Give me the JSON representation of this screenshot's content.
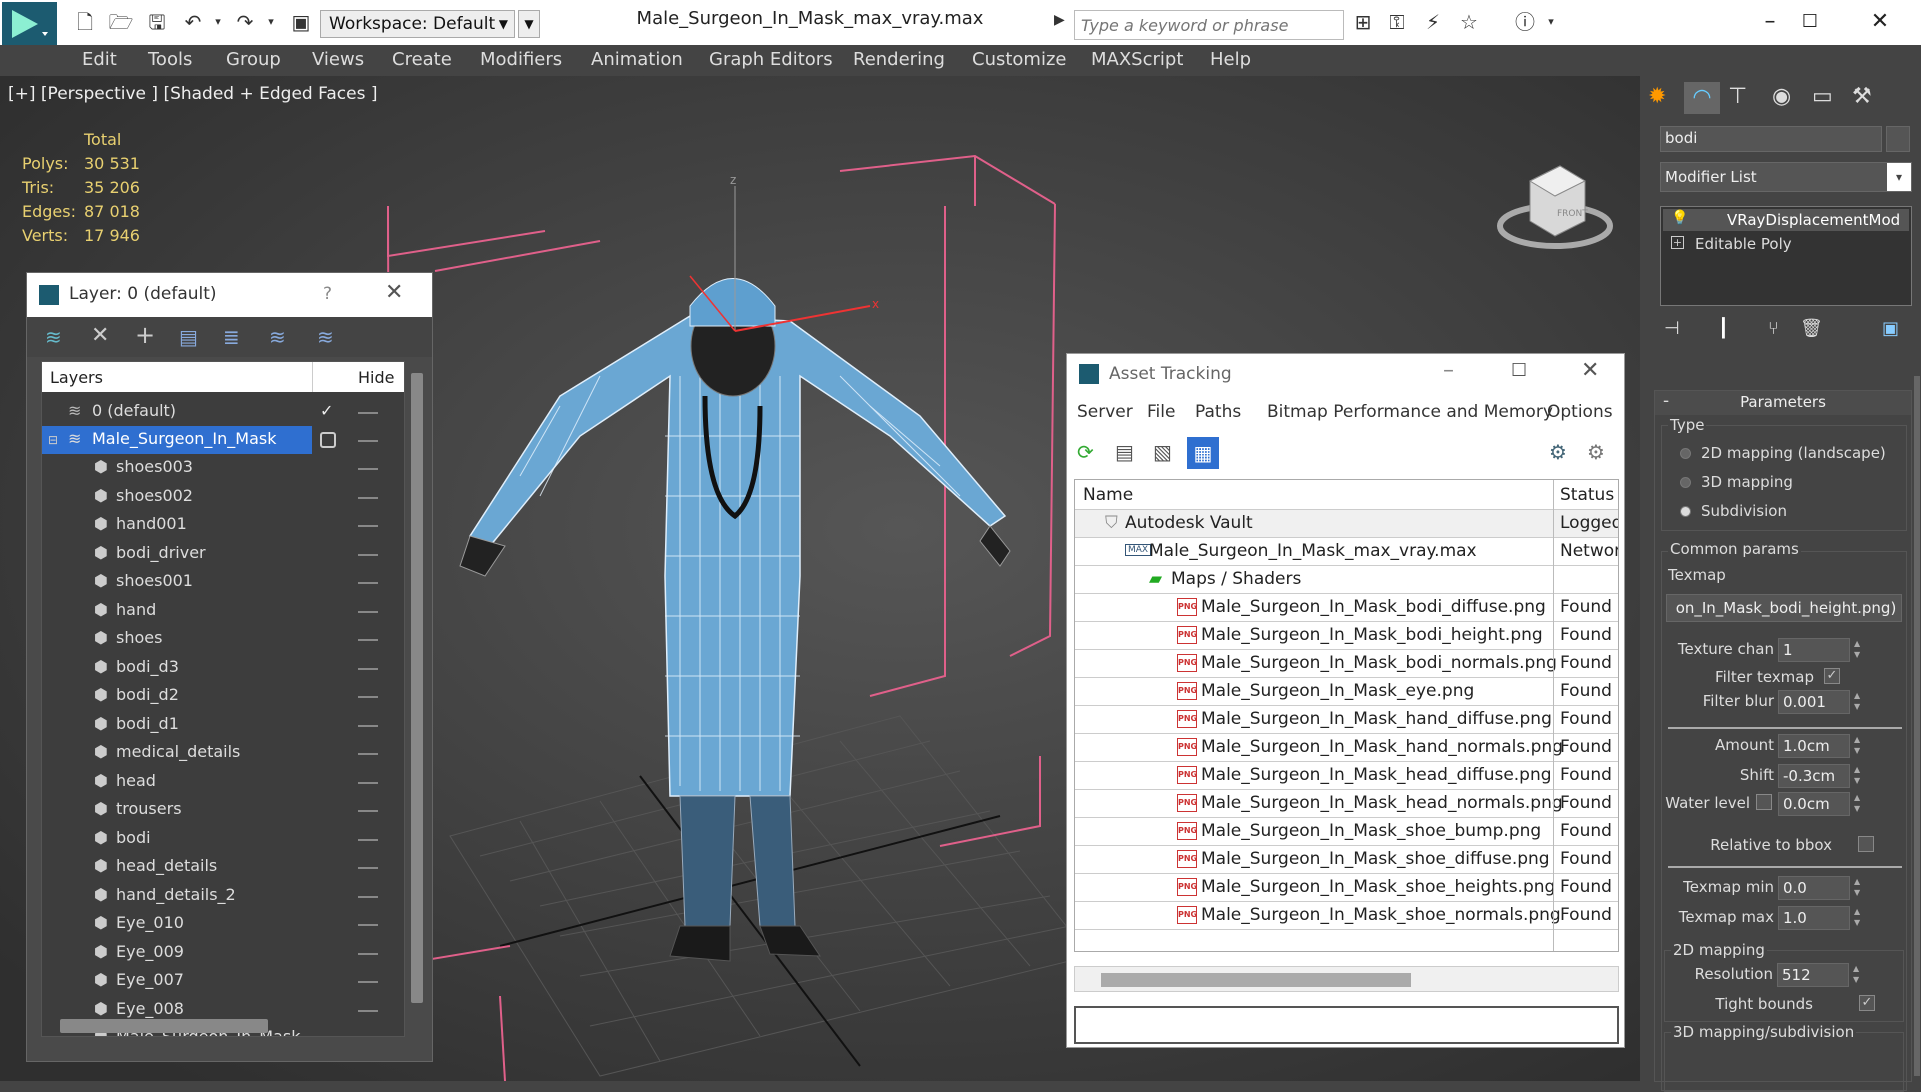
{
  "titlebar": {
    "workspace": "Workspace: Default",
    "doc_title": "Male_Surgeon_In_Mask_max_vray.max",
    "search_placeholder": "Type a keyword or phrase"
  },
  "menu": [
    "Edit",
    "Tools",
    "Group",
    "Views",
    "Create",
    "Modifiers",
    "Animation",
    "Graph Editors",
    "Rendering",
    "Customize",
    "MAXScript",
    "Help"
  ],
  "viewport": {
    "label": "[+] [Perspective ] [Shaded + Edged Faces ]",
    "stats_header": "Total",
    "stats": [
      {
        "label": "Polys:",
        "value": "30 531"
      },
      {
        "label": "Tris:",
        "value": "35 206"
      },
      {
        "label": "Edges:",
        "value": "87 018"
      },
      {
        "label": "Verts:",
        "value": "17 946"
      }
    ]
  },
  "layer_window": {
    "title": "Layer: 0 (default)",
    "help": "?",
    "col_layers": "Layers",
    "col_hide": "Hide",
    "default_layer": "0 (default)",
    "selected_layer": "Male_Surgeon_In_Mask",
    "objects": [
      "shoes003",
      "shoes002",
      "hand001",
      "bodi_driver",
      "shoes001",
      "hand",
      "shoes",
      "bodi_d3",
      "bodi_d2",
      "bodi_d1",
      "medical_details",
      "head",
      "trousers",
      "bodi",
      "head_details",
      "hand_details_2",
      "Eye_010",
      "Eye_009",
      "Eye_007",
      "Eye_008",
      "Male_Surgeon_In_Mask"
    ]
  },
  "asset_window": {
    "title": "Asset Tracking",
    "menu": [
      "Server",
      "File",
      "Paths",
      "Bitmap Performance and Memory",
      "Options"
    ],
    "col_name": "Name",
    "col_status": "Status",
    "vault": {
      "name": "Autodesk Vault",
      "status": "Logged"
    },
    "file": {
      "name": "Male_Surgeon_In_Mask_max_vray.max",
      "status": "Networ"
    },
    "maps_folder": "Maps / Shaders",
    "png_label": "PNG",
    "maps": [
      {
        "name": "Male_Surgeon_In_Mask_bodi_diffuse.png",
        "status": "Found"
      },
      {
        "name": "Male_Surgeon_In_Mask_bodi_height.png",
        "status": "Found"
      },
      {
        "name": "Male_Surgeon_In_Mask_bodi_normals.png",
        "status": "Found"
      },
      {
        "name": "Male_Surgeon_In_Mask_eye.png",
        "status": "Found"
      },
      {
        "name": "Male_Surgeon_In_Mask_hand_diffuse.png",
        "status": "Found"
      },
      {
        "name": "Male_Surgeon_In_Mask_hand_normals.png",
        "status": "Found"
      },
      {
        "name": "Male_Surgeon_In_Mask_head_diffuse.png",
        "status": "Found"
      },
      {
        "name": "Male_Surgeon_In_Mask_head_normals.png",
        "status": "Found"
      },
      {
        "name": "Male_Surgeon_In_Mask_shoe_bump.png",
        "status": "Found"
      },
      {
        "name": "Male_Surgeon_In_Mask_shoe_diffuse.png",
        "status": "Found"
      },
      {
        "name": "Male_Surgeon_In_Mask_shoe_heights.png",
        "status": "Found"
      },
      {
        "name": "Male_Surgeon_In_Mask_shoe_normals.png",
        "status": "Found"
      }
    ]
  },
  "command_panel": {
    "object_name": "bodi",
    "modifier_list": "Modifier List",
    "stack": [
      "VRayDisplacementMod",
      "Editable Poly"
    ],
    "rollout_title": "Parameters",
    "type_label": "Type",
    "type_options": [
      "2D mapping (landscape)",
      "3D mapping",
      "Subdivision"
    ],
    "type_selected": 2,
    "common_params": "Common params",
    "texmap_label": "Texmap",
    "texmap_value": "on_In_Mask_bodi_height.png)",
    "texture_chan_label": "Texture chan",
    "texture_chan": "1",
    "filter_texmap_label": "Filter texmap",
    "filter_texmap_mark": "✓",
    "filter_blur_label": "Filter blur",
    "filter_blur": "0.001",
    "amount_label": "Amount",
    "amount": "1.0cm",
    "shift_label": "Shift",
    "shift": "-0.3cm",
    "water_level_label": "Water level",
    "water_level": "0.0cm",
    "relative_bbox_label": "Relative to bbox",
    "texmap_min_label": "Texmap min",
    "texmap_min": "0.0",
    "texmap_max_label": "Texmap max",
    "texmap_max": "1.0",
    "mapping2d_label": "2D mapping",
    "resolution_label": "Resolution",
    "resolution": "512",
    "tight_bounds_label": "Tight bounds",
    "tight_bounds_mark": "✓",
    "mapping3d_label": "3D mapping/subdivision"
  },
  "colors": {
    "accent": "#1c5b70",
    "selection": "#2f6fd0",
    "stats": "#e8d070"
  }
}
